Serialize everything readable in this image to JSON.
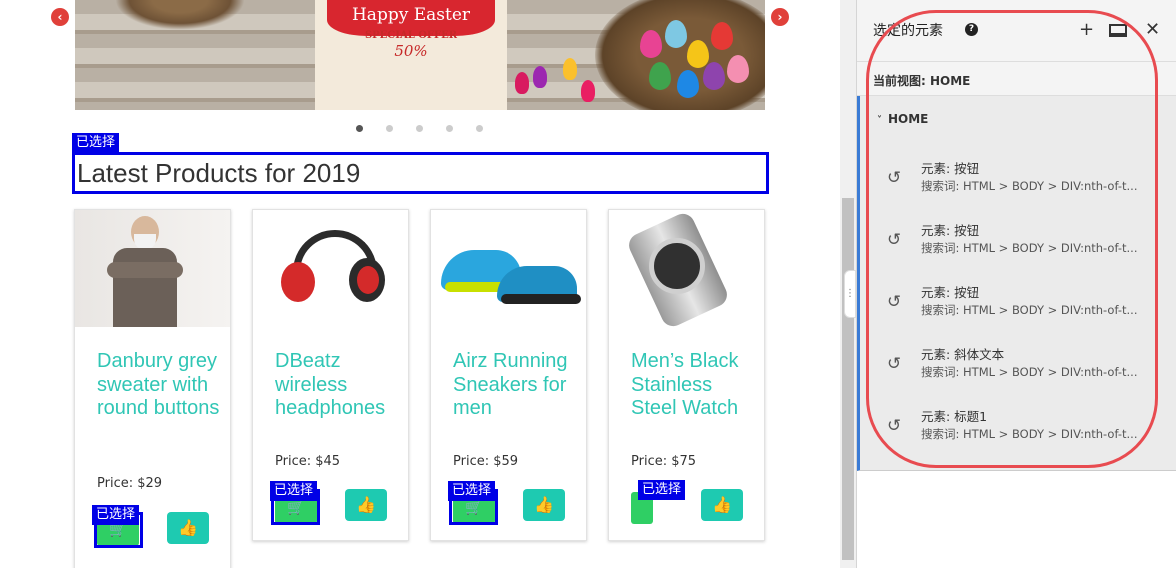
{
  "banner": {
    "ribbon_text": "Happy Easter",
    "offer_text": "SPECIAL OFFER",
    "percent_text": "50%",
    "prev_icon": "chevron-left-icon",
    "next_icon": "chevron-right-icon",
    "active_dot": 1,
    "dot_count": 5
  },
  "selected_tag": "已选择",
  "heading": "Latest Products for 2019",
  "products": [
    {
      "name": "Danbury grey sweater with round buttons",
      "price": "Price: $29"
    },
    {
      "name": "DBeatz wireless headphones",
      "price": "Price: $45"
    },
    {
      "name": "Airz Running Sneakers for men",
      "price": "Price: $59"
    },
    {
      "name": "Men’s Black Stainless Steel Watch",
      "price": "Price: $75"
    }
  ],
  "panel": {
    "title": "选定的元素",
    "view_label": "当前视图: HOME",
    "group": "HOME",
    "items": [
      {
        "element": "元素: 按钮",
        "selector": "搜索词: HTML > BODY > DIV:nth-of-t..."
      },
      {
        "element": "元素: 按钮",
        "selector": "搜索词: HTML > BODY > DIV:nth-of-t..."
      },
      {
        "element": "元素: 按钮",
        "selector": "搜索词: HTML > BODY > DIV:nth-of-t..."
      },
      {
        "element": "元素: 斜体文本",
        "selector": "搜索词: HTML > BODY > DIV:nth-of-t..."
      },
      {
        "element": "元素: 标题1",
        "selector": "搜索词: HTML > BODY > DIV:nth-of-t..."
      }
    ]
  },
  "colors": {
    "accent_teal": "#30c6b5",
    "cart_green": "#2fcf64",
    "selection_blue": "#0000e6",
    "annotation_red": "#e84b50"
  }
}
